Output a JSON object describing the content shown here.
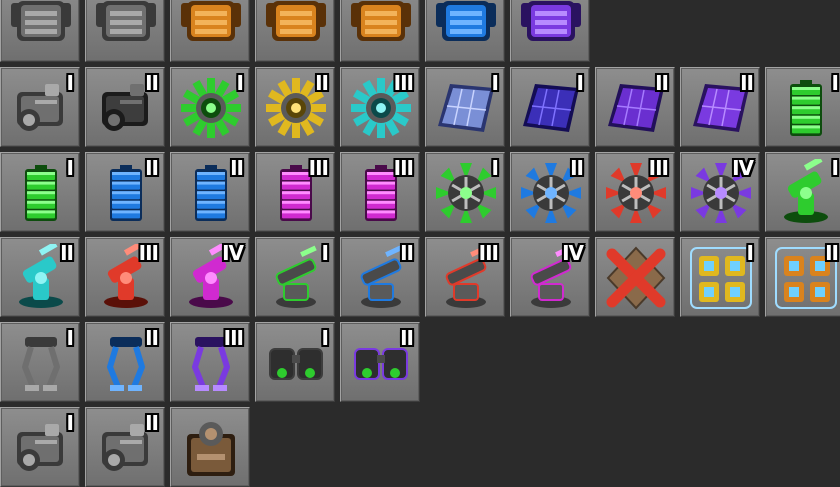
{
  "colors": {
    "background": "#2b2b2b",
    "slot": "#7e7e7e",
    "green": "#2ecc2e",
    "blue": "#1f7ae0",
    "magenta": "#d02ad0",
    "red": "#e03a2a",
    "orange": "#d9831e",
    "teal": "#2ac9c9",
    "purple": "#7a3ae0"
  },
  "rows": [
    {
      "items": [
        {
          "icon": "armor-plate-icon",
          "variant": "gray",
          "tier": ""
        },
        {
          "icon": "armor-plate-icon",
          "variant": "gray",
          "tier": ""
        },
        {
          "icon": "armor-plate-icon",
          "variant": "orange",
          "tier": ""
        },
        {
          "icon": "armor-plate-icon",
          "variant": "orange",
          "tier": ""
        },
        {
          "icon": "armor-plate-icon",
          "variant": "orange",
          "tier": ""
        },
        {
          "icon": "armor-plate-icon",
          "variant": "blue",
          "tier": ""
        },
        {
          "icon": "armor-plate-icon",
          "variant": "purple",
          "tier": ""
        }
      ]
    },
    {
      "items": [
        {
          "icon": "engine-icon",
          "variant": "gray",
          "tier": "I"
        },
        {
          "icon": "engine-icon",
          "variant": "dark",
          "tier": "II"
        },
        {
          "icon": "energy-shield-icon",
          "variant": "green",
          "tier": "I"
        },
        {
          "icon": "energy-shield-icon",
          "variant": "yellow",
          "tier": "II"
        },
        {
          "icon": "energy-shield-icon",
          "variant": "teal",
          "tier": "III"
        },
        {
          "icon": "solar-panel-icon",
          "variant": "lightblue",
          "tier": "I"
        },
        {
          "icon": "solar-panel-icon",
          "variant": "indigo",
          "tier": "I"
        },
        {
          "icon": "solar-panel-icon",
          "variant": "violet",
          "tier": "II"
        },
        {
          "icon": "solar-panel-icon",
          "variant": "purple",
          "tier": "II"
        },
        {
          "icon": "battery-icon",
          "variant": "green",
          "tier": "I"
        }
      ]
    },
    {
      "items": [
        {
          "icon": "battery-icon",
          "variant": "green",
          "tier": "I"
        },
        {
          "icon": "battery-icon",
          "variant": "blue",
          "tier": "II"
        },
        {
          "icon": "battery-icon",
          "variant": "blue",
          "tier": "II"
        },
        {
          "icon": "battery-icon",
          "variant": "magenta",
          "tier": "III"
        },
        {
          "icon": "battery-icon",
          "variant": "magenta",
          "tier": "III"
        },
        {
          "icon": "exoskeleton-icon",
          "variant": "green",
          "tier": "I"
        },
        {
          "icon": "exoskeleton-icon",
          "variant": "blue",
          "tier": "II"
        },
        {
          "icon": "exoskeleton-icon",
          "variant": "red",
          "tier": "III"
        },
        {
          "icon": "exoskeleton-icon",
          "variant": "purple",
          "tier": "IV"
        },
        {
          "icon": "turret-icon",
          "variant": "green",
          "tier": "I"
        }
      ]
    },
    {
      "items": [
        {
          "icon": "turret-icon",
          "variant": "teal",
          "tier": "II"
        },
        {
          "icon": "turret-icon",
          "variant": "red",
          "tier": "III"
        },
        {
          "icon": "turret-icon",
          "variant": "magenta",
          "tier": "IV"
        },
        {
          "icon": "laser-turret-icon",
          "variant": "green",
          "tier": "I"
        },
        {
          "icon": "laser-turret-icon",
          "variant": "blue",
          "tier": "II"
        },
        {
          "icon": "laser-turret-icon",
          "variant": "red",
          "tier": "III"
        },
        {
          "icon": "laser-turret-icon",
          "variant": "magenta",
          "tier": "IV"
        },
        {
          "icon": "disabled-x-icon",
          "variant": "red",
          "tier": ""
        },
        {
          "icon": "robot-swarm-icon",
          "variant": "yellow",
          "tier": "I"
        },
        {
          "icon": "robot-swarm-icon",
          "variant": "orange",
          "tier": "II"
        }
      ]
    },
    {
      "items": [
        {
          "icon": "legs-icon",
          "variant": "gray",
          "tier": "I"
        },
        {
          "icon": "legs-icon",
          "variant": "blue",
          "tier": "II"
        },
        {
          "icon": "legs-icon",
          "variant": "purple",
          "tier": "III"
        },
        {
          "icon": "night-vision-icon",
          "variant": "dark",
          "tier": "I"
        },
        {
          "icon": "night-vision-icon",
          "variant": "purple",
          "tier": "II"
        }
      ]
    },
    {
      "items": [
        {
          "icon": "engine-icon",
          "variant": "gray",
          "tier": "I"
        },
        {
          "icon": "engine-icon",
          "variant": "gray",
          "tier": "II"
        },
        {
          "icon": "reactor-icon",
          "variant": "brown",
          "tier": ""
        }
      ]
    }
  ]
}
